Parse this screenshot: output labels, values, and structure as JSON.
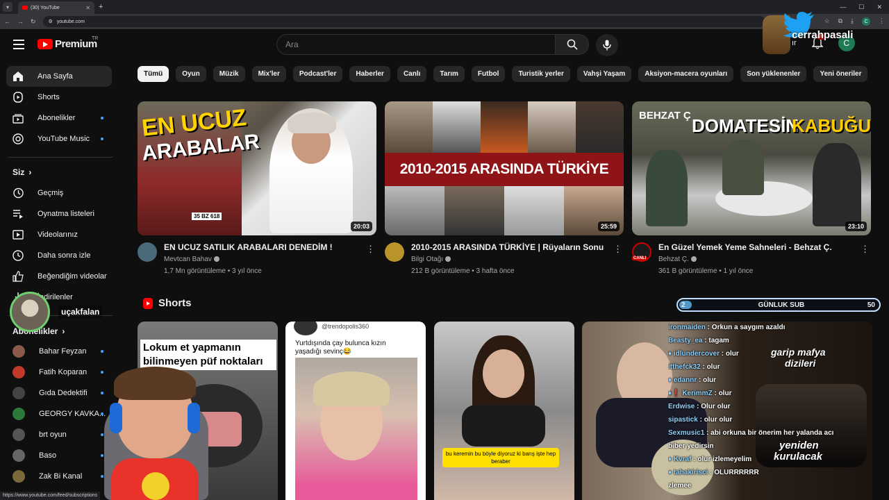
{
  "browser": {
    "tab_title": "(30) YouTube",
    "url": "youtube.com",
    "ext_avatar": "C"
  },
  "header": {
    "logo": "Premium",
    "country": "TR",
    "search_placeholder": "Ara",
    "create_label": "ır",
    "notif_badge": "9+",
    "avatar_letter": "C"
  },
  "sidebar": {
    "main": [
      {
        "label": "Ana Sayfa",
        "icon": "home-icon",
        "active": true
      },
      {
        "label": "Shorts",
        "icon": "shorts-icon"
      },
      {
        "label": "Abonelikler",
        "icon": "subscriptions-icon",
        "dot": true
      },
      {
        "label": "YouTube Music",
        "icon": "music-icon",
        "dot": true
      }
    ],
    "you_title": "Siz",
    "you_items": [
      {
        "label": "Geçmiş",
        "icon": "history-icon"
      },
      {
        "label": "Oynatma listeleri",
        "icon": "playlist-icon"
      },
      {
        "label": "Videolarınız",
        "icon": "your-videos-icon"
      },
      {
        "label": "Daha sonra izle",
        "icon": "watch-later-icon"
      },
      {
        "label": "Beğendiğim videolar",
        "icon": "liked-icon"
      },
      {
        "label": "İndirilenler",
        "icon": "download-icon"
      }
    ],
    "subs_title": "Abonelikler",
    "subs": [
      {
        "label": "Bahar Feyzan",
        "color": "#8a5a4a"
      },
      {
        "label": "Fatih Koparan",
        "color": "#c0392b"
      },
      {
        "label": "Gıda Dedektifi",
        "color": "#444"
      },
      {
        "label": "GEORGY KAVKA...",
        "color": "#2c7a3a"
      },
      {
        "label": "brt oyun",
        "color": "#555"
      },
      {
        "label": "Baso",
        "color": "#666"
      },
      {
        "label": "Zak Bi Kanal",
        "color": "#7a6a3a"
      }
    ]
  },
  "chips": [
    "Tümü",
    "Oyun",
    "Müzik",
    "Mix'ler",
    "Podcast'ler",
    "Haberler",
    "Canlı",
    "Tarım",
    "Futbol",
    "Turistik yerler",
    "Vahşi Yaşam",
    "Aksiyon-macera oyunları",
    "Son yüklenenler",
    "Yeni öneriler"
  ],
  "videos": [
    {
      "title": "EN UCUZ SATILIK ARABALARI DENEDİM !",
      "channel": "Mevtcan Bahav",
      "meta": "1,7 Mn görüntüleme • 3 yıl önce",
      "duration": "20:03",
      "thumb_text_1": "EN UCUZ",
      "thumb_text_2": "ARABALAR",
      "plate": "35 BZ 618"
    },
    {
      "title": "2010-2015 ARASINDA TÜRKİYE | Rüyaların Sonu",
      "channel": "Bilgi Otağı",
      "meta": "212 B görüntüleme • 3 hafta önce",
      "duration": "25:59",
      "thumb_text_1": "2010-2015 ARASINDA TÜRKİYE"
    },
    {
      "title": "En Güzel Yemek Yeme Sahneleri - Behzat Ç.",
      "channel": "Behzat Ç.",
      "meta": "361 B görüntüleme • 1 yıl önce",
      "duration": "23:10",
      "thumb_text_1": "BEHZAT Ç",
      "thumb_text_2": "DOMATESİN",
      "thumb_text_3": "KABUĞU",
      "live": "CANLI"
    }
  ],
  "shorts_title": "Shorts",
  "shorts": [
    {
      "caption": "Lokum et yapmanın bilinmeyen püf noktaları"
    },
    {
      "handle": "@trendopolis360",
      "caption": "Yurtdışında çay bulunca kızın yaşadığı sevinç😂"
    },
    {
      "caption": "bu keremin bu böyle diyoruz ki barış işte hep beraber"
    },
    {
      "caption_1": "garip mafya",
      "caption_2": "dizileri",
      "caption_3": "yeniden",
      "caption_4": "kurulacak"
    }
  ],
  "overlay": {
    "twitter_handle": "cerrahpasali",
    "webcam_name": "uçakfalan",
    "goal_left": "2",
    "goal_title": "GÜNLUK SUB",
    "goal_right": "50",
    "chat": [
      {
        "user": "ironmaiden",
        "msg": " : Orkun a saygım azaldı"
      },
      {
        "user": "Beasty_ea",
        "msg": " : tagam"
      },
      {
        "user": "♦ idlundercover",
        "msg": " : olur"
      },
      {
        "user": "itthefck32",
        "msg": " : olur"
      },
      {
        "user": "♦ edannr",
        "msg": " : olur"
      },
      {
        "user": "♦❗ KerimmZ",
        "msg": " : olur"
      },
      {
        "user": "Erdwise",
        "msg": " : Olur olur"
      },
      {
        "user": "sipastick",
        "msg": " : olur olur"
      },
      {
        "user": "Sexmusic1",
        "msg": " : abi orkuna bir önerim her yalanda acı"
      },
      {
        "user": "",
        "msg": "biber yedirsin"
      },
      {
        "user": "♦ Kvraf",
        "msg": " : olur izlemeyelim"
      },
      {
        "user": "♦ tahakirisci",
        "msg": " : OLURRRRRR"
      },
      {
        "user": "",
        "msg": "zlemee"
      }
    ]
  },
  "status_url": "https://www.youtube.com/feed/subscriptions"
}
